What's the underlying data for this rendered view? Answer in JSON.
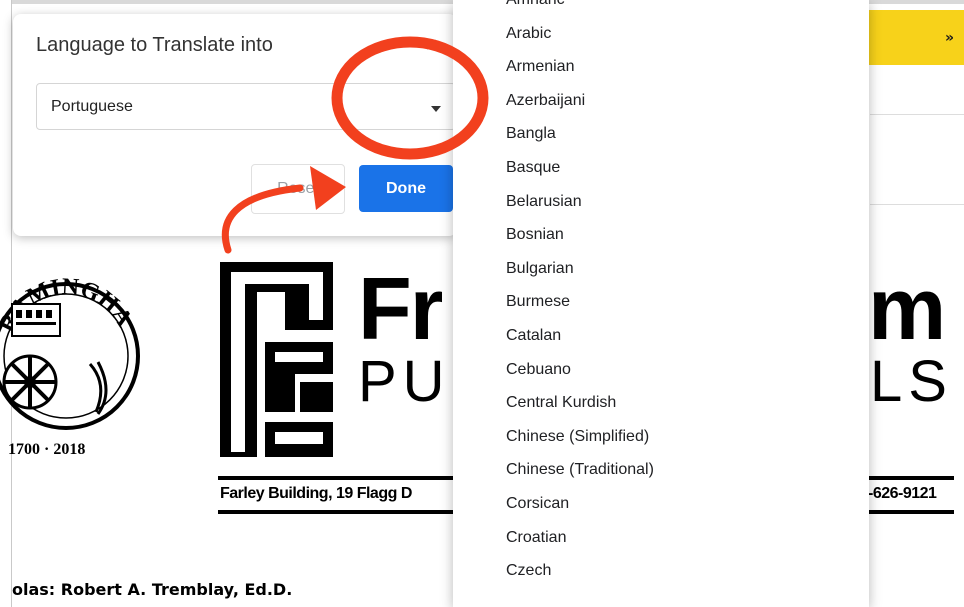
{
  "dialog": {
    "title": "Language to Translate into",
    "close_glyph": "×",
    "selected_language": "Portuguese",
    "reset_label": "Reset",
    "done_label": "Done"
  },
  "dropdown": {
    "items": [
      "Amharic",
      "Arabic",
      "Armenian",
      "Azerbaijani",
      "Bangla",
      "Basque",
      "Belarusian",
      "Bosnian",
      "Bulgarian",
      "Burmese",
      "Catalan",
      "Cebuano",
      "Central Kurdish",
      "Chinese (Simplified)",
      "Chinese (Traditional)",
      "Corsican",
      "Croatian",
      "Czech"
    ]
  },
  "background": {
    "logo_text_left": "Fr",
    "logo_text_right": "m",
    "logo_sub_left": "PU",
    "logo_sub_right": "LS",
    "address_left": "Farley Building, 19 Flagg D",
    "address_right": "-626-9121",
    "footer_text": "olas: Robert A. Tremblay, Ed.D.",
    "seal_top_text": "RAMINGHAM",
    "seal_bottom_text": "1700 · 2018",
    "banner_chevron": "»"
  },
  "colors": {
    "accent": "#1a73e8",
    "annotation_red": "#f2401e",
    "banner_yellow": "#f7d21a"
  }
}
